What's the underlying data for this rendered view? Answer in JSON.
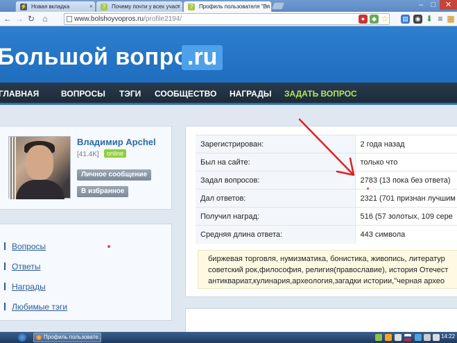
{
  "browser": {
    "tabs": [
      {
        "title": "Новая вкладка"
      },
      {
        "title": "Почему почти у всех участ"
      },
      {
        "title": "Профиль пользователя \"Вл"
      }
    ],
    "url_host": "www.bolshoyvopros.ru",
    "url_path": "/profile2194/"
  },
  "site": {
    "logo_text": "Большой вопрос",
    "logo_suffix": ".ru",
    "nav": {
      "home": "ГЛАВНАЯ",
      "questions": "ВОПРОСЫ",
      "tags": "ТЭГИ",
      "community": "СООБЩЕСТВО",
      "awards": "НАГРАДЫ",
      "ask": "ЗАДАТЬ ВОПРОС"
    }
  },
  "profile": {
    "name": "Владимир Apchel",
    "rating": "[41.4K]",
    "status": "online",
    "message_button": "Личное сообщение",
    "favorite_button": "В избранное"
  },
  "menu": {
    "items": [
      "Вопросы",
      "Ответы",
      "Награды",
      "Любимые тэги"
    ]
  },
  "stats": {
    "rows": [
      {
        "label": "Зарегистрирован:",
        "value": "2 года назад"
      },
      {
        "label": "Был на сайте:",
        "value": "только что"
      },
      {
        "label": "Задал вопросов:",
        "value": "2783 (13 пока без ответа)"
      },
      {
        "label": "Дал ответов:",
        "value": "2321 (701 признан лучшим"
      },
      {
        "label": "Получил наград:",
        "value": "516 (57 золотых, 109 сере"
      },
      {
        "label": "Средняя длина ответа:",
        "value": "443 символа"
      }
    ],
    "interests": [
      "биржевая торговля, нумизматика, бонистика, живопись, литератур",
      "советский рок,философия, религия(православие), история Отечест",
      "антиквариат,кулинария,археология,загадки истории,\"черная архео"
    ]
  },
  "taskbar": {
    "window_title": "Профиль пользовате...",
    "clock": "14:22"
  },
  "colors": {
    "header_blue": "#2277c8",
    "nav_dark": "#24313f",
    "ask_green": "#b5e65f",
    "link_blue": "#2a5d96",
    "arrow_red": "#e02020"
  }
}
